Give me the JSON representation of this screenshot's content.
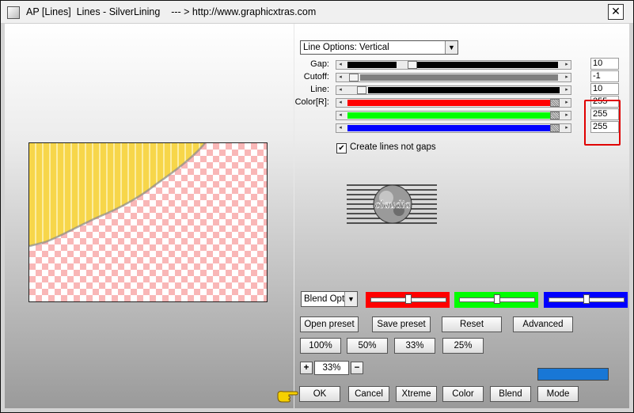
{
  "window": {
    "title": "AP [Lines]  Lines - SilverLining    --- > http://www.graphicxtras.com",
    "close_label": "✕"
  },
  "options": {
    "selected": "Line Options: Vertical",
    "arrow": "▼"
  },
  "sliders": [
    {
      "label": "Gap:",
      "value": "10",
      "color": "#000000",
      "level": 0.27
    },
    {
      "label": "Cutoff:",
      "value": "-1",
      "color": "#808080",
      "level": 0.0
    },
    {
      "label": "Line:",
      "value": "10",
      "color": "#000000",
      "level": 0.04
    },
    {
      "label": "Color[R]:",
      "value": "255",
      "color": "#ff0000",
      "level": 1.0
    },
    {
      "label": "",
      "value": "255",
      "color": "#00ff00",
      "level": 1.0
    },
    {
      "label": "",
      "value": "255",
      "color": "#0000ff",
      "level": 1.0
    }
  ],
  "checkbox": {
    "label": "Create lines not gaps",
    "checked": true,
    "mark": "✔"
  },
  "logo": {
    "text": "claudia"
  },
  "blend": {
    "selected": "Blend Options",
    "arrow": "▼"
  },
  "color_boxes": [
    {
      "color": "#ff0000",
      "level": 0.5
    },
    {
      "color": "#00ff00",
      "level": 0.5
    },
    {
      "color": "#0000ff",
      "level": 0.5
    }
  ],
  "preset_buttons": [
    "Open preset",
    "Save preset",
    "Reset",
    "Advanced"
  ],
  "zoom_buttons": [
    "100%",
    "50%",
    "33%",
    "25%"
  ],
  "zoom": {
    "plus": "+",
    "value": "33%",
    "minus": "−"
  },
  "bottom_buttons": [
    "OK",
    "Cancel",
    "Xtreme",
    "Color",
    "Blend",
    "Mode"
  ],
  "accent": "#1877d6"
}
